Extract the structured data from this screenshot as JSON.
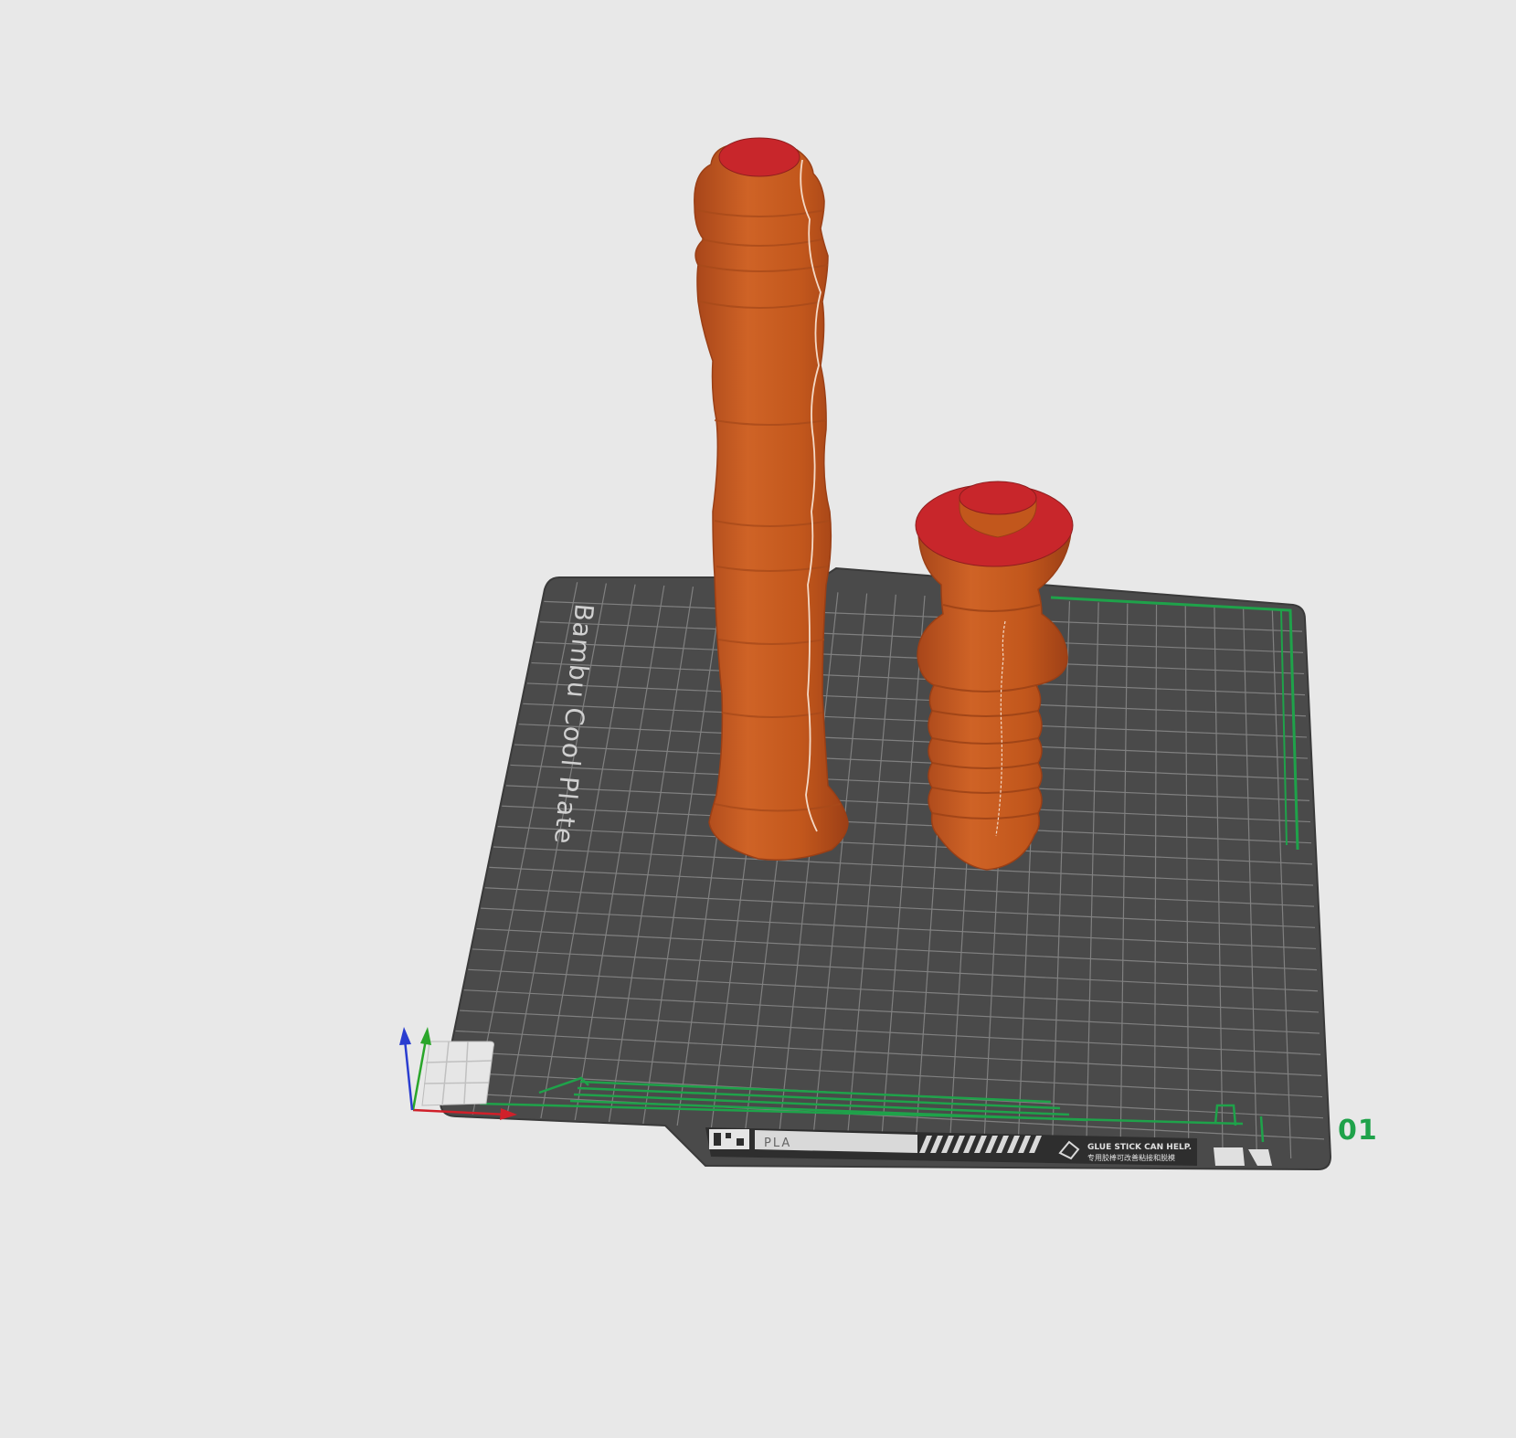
{
  "viewport": {
    "plate": {
      "name": "Bambu Cool Plate",
      "filament_label": "PLA",
      "notice_en": "GLUE STICK CAN HELP.",
      "notice_cn": "专用胶棒可改善粘接和脱模",
      "plate_number": "01",
      "colors": {
        "plate": "#4a4a4a",
        "grid": "#8a8a8a",
        "accent_green": "#1fa24a",
        "label_strip": "#d9d9d9"
      }
    },
    "objects": [
      {
        "name": "tall-turned-column",
        "body_color": "#c2571c",
        "top_color": "#c8262b"
      },
      {
        "name": "short-ribbed-column",
        "body_color": "#c2571c",
        "top_color": "#c8262b"
      }
    ],
    "axes": {
      "x_color": "#d0202a",
      "y_color": "#2aa62a",
      "z_color": "#2a3dd0"
    }
  }
}
